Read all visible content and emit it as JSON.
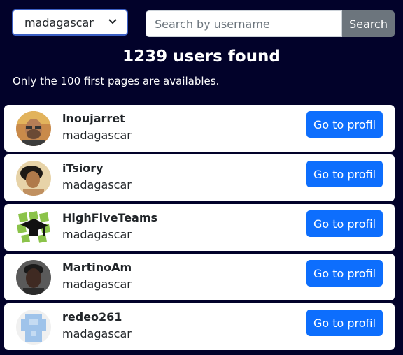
{
  "filter": {
    "selected": "madagascar"
  },
  "search": {
    "placeholder": "Search by username",
    "value": "",
    "button": "Search"
  },
  "summary": {
    "count": "1239 users found",
    "notice": "Only the 100 first pages are availables."
  },
  "users": [
    {
      "username": "lnoujarret",
      "country": "madagascar",
      "button": "Go to profil",
      "avatar": "photo-man-beard"
    },
    {
      "username": "iTsiory",
      "country": "madagascar",
      "button": "Go to profil",
      "avatar": "photo-person-dark-hair"
    },
    {
      "username": "HighFiveTeams",
      "country": "madagascar",
      "button": "Go to profil",
      "avatar": "graduation-cap-logo"
    },
    {
      "username": "MartinoAm",
      "country": "madagascar",
      "button": "Go to profil",
      "avatar": "photo-man-dark"
    },
    {
      "username": "redeo261",
      "country": "madagascar",
      "button": "Go to profil",
      "avatar": "identicon-blue"
    }
  ],
  "colors": {
    "background": "#02022a",
    "primary": "#0d6efd",
    "secondary": "#6c757d"
  }
}
